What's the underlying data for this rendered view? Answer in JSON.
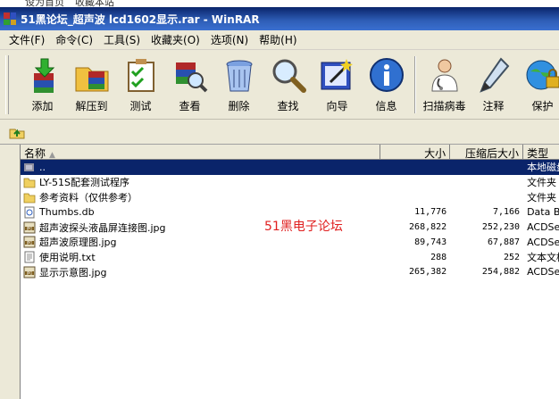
{
  "top_strip": {
    "items": [
      "设为首页",
      "收藏本站"
    ]
  },
  "window": {
    "title": "51黑论坛_超声波 lcd1602显示.rar - WinRAR"
  },
  "menu": [
    {
      "label": "文件(F)"
    },
    {
      "label": "命令(C)"
    },
    {
      "label": "工具(S)"
    },
    {
      "label": "收藏夹(O)"
    },
    {
      "label": "选项(N)"
    },
    {
      "label": "帮助(H)"
    }
  ],
  "toolbar": [
    {
      "label": "添加",
      "icon": "add-archive-icon"
    },
    {
      "label": "解压到",
      "icon": "extract-to-icon"
    },
    {
      "label": "测试",
      "icon": "test-icon"
    },
    {
      "label": "查看",
      "icon": "view-icon"
    },
    {
      "label": "删除",
      "icon": "delete-icon"
    },
    {
      "label": "查找",
      "icon": "find-icon"
    },
    {
      "label": "向导",
      "icon": "wizard-icon"
    },
    {
      "label": "信息",
      "icon": "info-icon"
    },
    {
      "label": "扫描病毒",
      "icon": "virus-scan-icon"
    },
    {
      "label": "注释",
      "icon": "comment-icon"
    },
    {
      "label": "保护",
      "icon": "protect-icon"
    }
  ],
  "columns": {
    "name": "名称",
    "size": "大小",
    "packed": "压缩后大小",
    "type": "类型"
  },
  "files": [
    {
      "name": "..",
      "size": "",
      "packed": "",
      "type": "本地磁盘",
      "kind": "up",
      "selected": true
    },
    {
      "name": "LY-51S配套测试程序",
      "size": "",
      "packed": "",
      "type": "文件夹",
      "kind": "folder"
    },
    {
      "name": "参考资料（仅供参考）",
      "size": "",
      "packed": "",
      "type": "文件夹",
      "kind": "folder"
    },
    {
      "name": "Thumbs.db",
      "size": "11,776",
      "packed": "7,166",
      "type": "Data Base",
      "kind": "db"
    },
    {
      "name": "超声波探头液晶屏连接图.jpg",
      "size": "268,822",
      "packed": "252,230",
      "type": "ACDSee",
      "kind": "jpg"
    },
    {
      "name": "超声波原理图.jpg",
      "size": "89,743",
      "packed": "67,887",
      "type": "ACDSee",
      "kind": "jpg"
    },
    {
      "name": "使用说明.txt",
      "size": "288",
      "packed": "252",
      "type": "文本文档",
      "kind": "txt"
    },
    {
      "name": "显示示意图.jpg",
      "size": "265,382",
      "packed": "254,882",
      "type": "ACDSee",
      "kind": "jpg"
    }
  ],
  "watermark": "51黑电子论坛",
  "colors": {
    "title_bar": "#0a246a",
    "selection": "#0a246a",
    "chrome": "#ece9d8",
    "watermark": "#e02020"
  }
}
